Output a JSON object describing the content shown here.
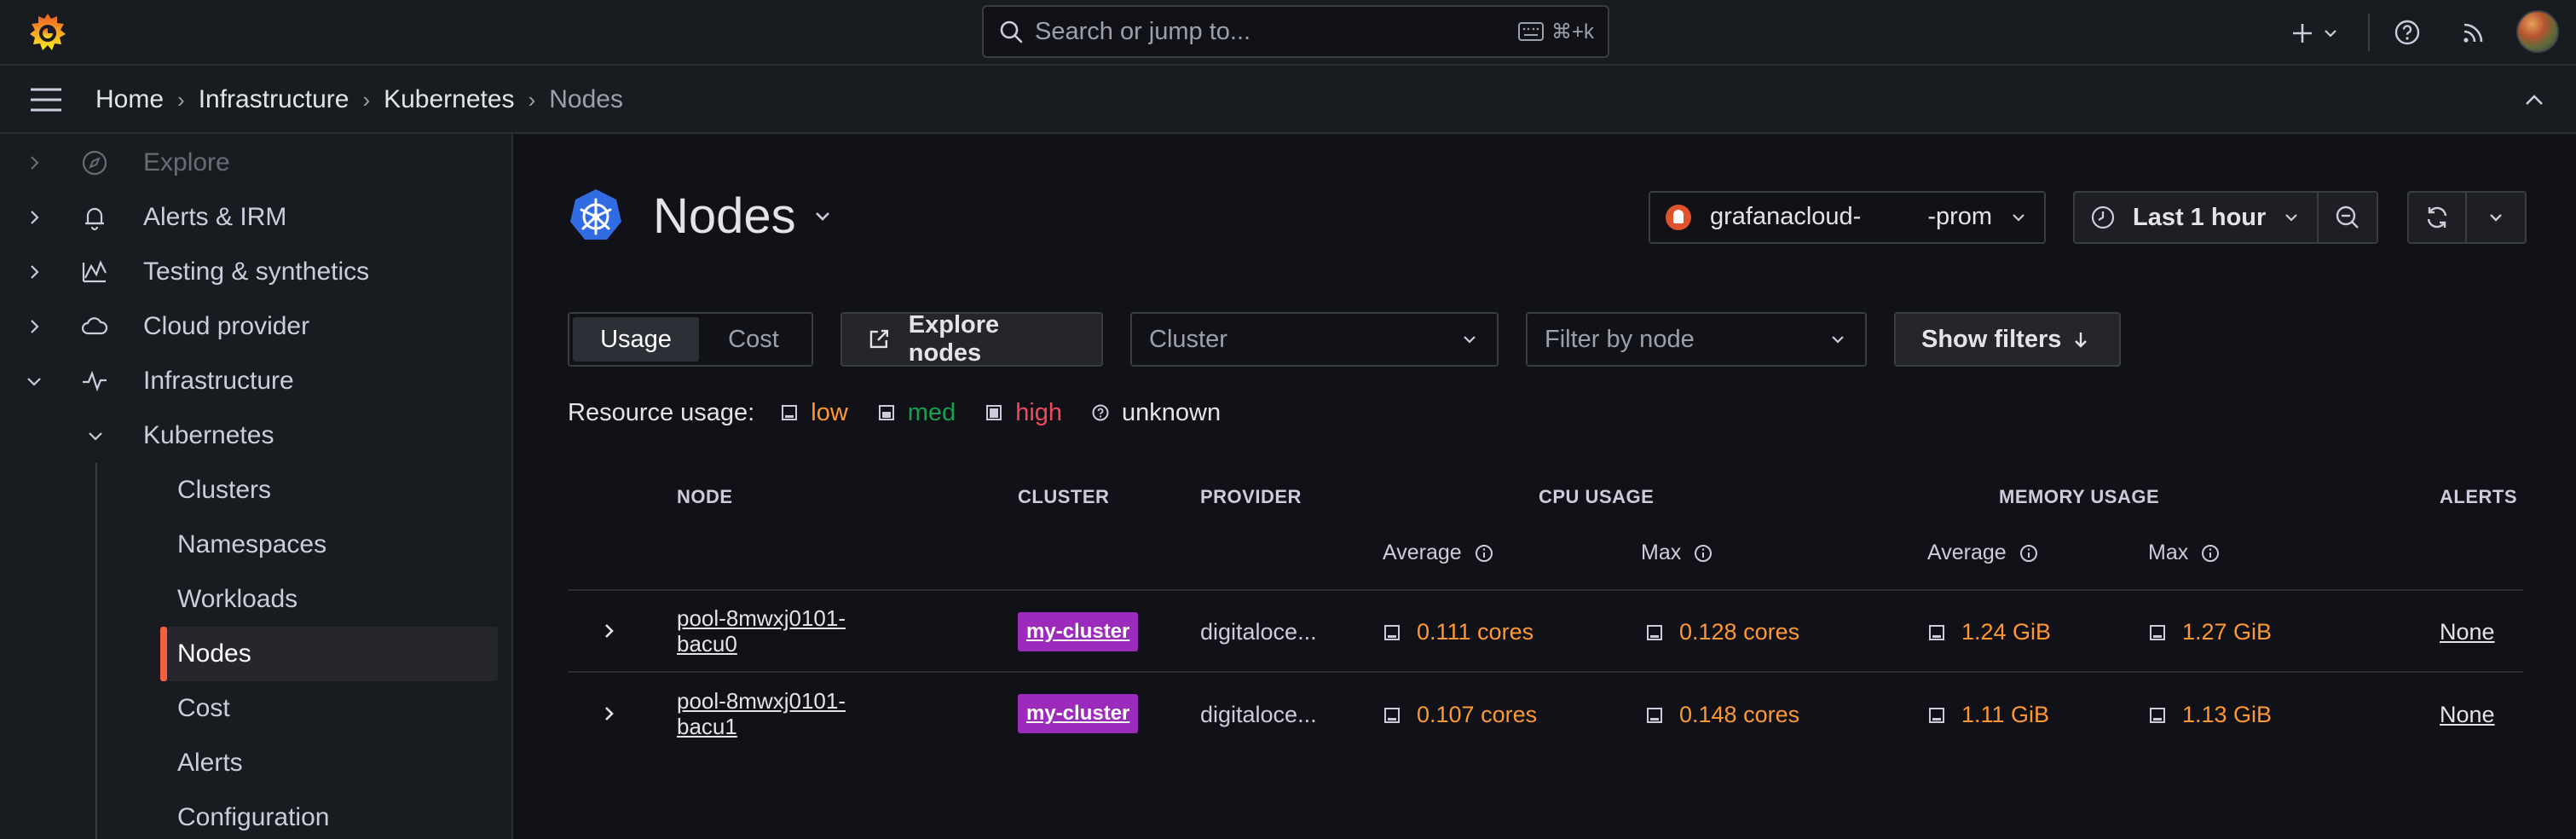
{
  "topbar": {
    "search_placeholder": "Search or jump to...",
    "search_shortcut": "⌘+k"
  },
  "breadcrumb": {
    "items": [
      "Home",
      "Infrastructure",
      "Kubernetes",
      "Nodes"
    ],
    "separator": "›"
  },
  "sidebar": {
    "items": [
      {
        "label": "Explore",
        "icon": "compass-icon"
      },
      {
        "label": "Alerts & IRM",
        "icon": "bell-icon"
      },
      {
        "label": "Testing & synthetics",
        "icon": "synthetics-icon"
      },
      {
        "label": "Cloud provider",
        "icon": "cloud-icon"
      },
      {
        "label": "Infrastructure",
        "icon": "heartbeat-icon"
      }
    ],
    "kubernetes_label": "Kubernetes",
    "kubernetes_children": [
      "Clusters",
      "Namespaces",
      "Workloads",
      "Nodes",
      "Cost",
      "Alerts",
      "Configuration"
    ],
    "active_child": "Nodes"
  },
  "page": {
    "title": "Nodes",
    "datasource_prefix": "grafanacloud-",
    "datasource_suffix": "-prom",
    "time_range": "Last 1 hour"
  },
  "toolbar": {
    "tabs": [
      "Usage",
      "Cost"
    ],
    "active_tab": "Usage",
    "explore_label": "Explore nodes",
    "cluster_placeholder": "Cluster",
    "node_placeholder": "Filter by node",
    "show_filters_label": "Show filters"
  },
  "legend": {
    "label": "Resource usage:",
    "items": [
      {
        "label": "low",
        "color": "#ff9830"
      },
      {
        "label": "med",
        "color": "#1a9e50"
      },
      {
        "label": "high",
        "color": "#f2495c"
      },
      {
        "label": "unknown",
        "color": "#e3e4ea"
      }
    ]
  },
  "table": {
    "headers": {
      "node": "NODE",
      "cluster": "CLUSTER",
      "provider": "PROVIDER",
      "cpu": "CPU USAGE",
      "memory": "MEMORY USAGE",
      "alerts": "ALERTS"
    },
    "subheaders": {
      "cpu_avg": "Average",
      "cpu_max": "Max",
      "mem_avg": "Average",
      "mem_max": "Max"
    },
    "rows": [
      {
        "node_line1": "pool-8mwxj0101-",
        "node_line2": "bacu0",
        "cluster": "my-cluster",
        "provider": "digitaloce...",
        "cpu_avg": "0.111 cores",
        "cpu_max": "0.128 cores",
        "mem_avg": "1.24 GiB",
        "mem_max": "1.27 GiB",
        "alerts": "None"
      },
      {
        "node_line1": "pool-8mwxj0101-",
        "node_line2": "bacu1",
        "cluster": "my-cluster",
        "provider": "digitaloce...",
        "cpu_avg": "0.107 cores",
        "cpu_max": "0.148 cores",
        "mem_avg": "1.11 GiB",
        "mem_max": "1.13 GiB",
        "alerts": "None"
      }
    ]
  },
  "colors": {
    "accent": "#f55f3e",
    "low_usage": "#ff9830",
    "cluster_tag": "#9c2bbd",
    "k8s_blue": "#326ce5"
  }
}
